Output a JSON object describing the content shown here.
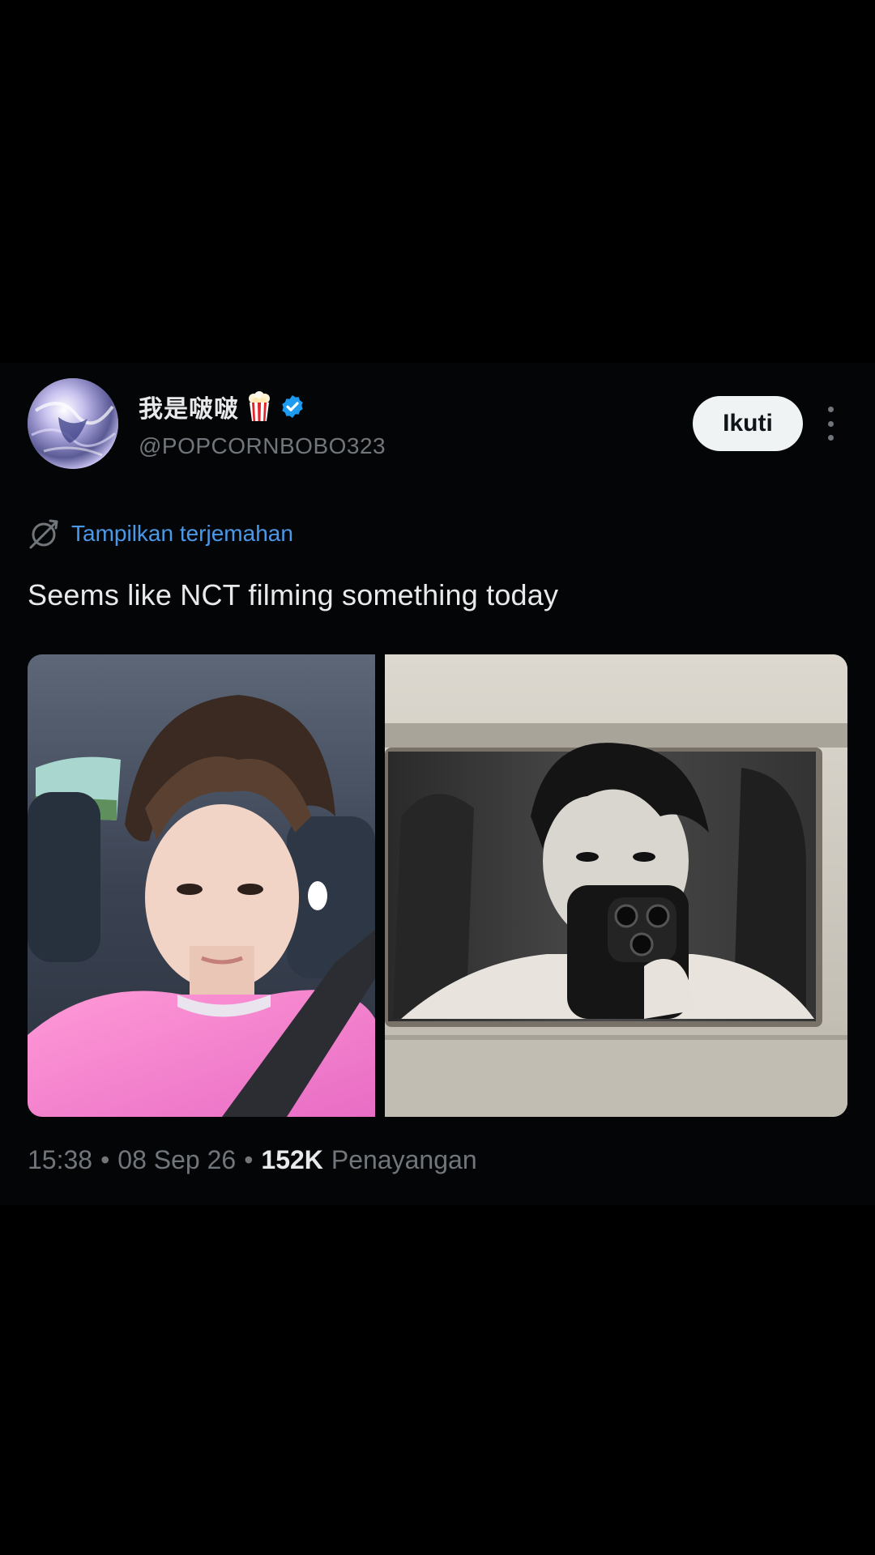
{
  "tweet": {
    "author": {
      "display_name": "我是啵啵",
      "handle": "@POPCORNBOBO323",
      "badge_icon": "popcorn-icon",
      "verified_icon": "verified-badge-icon",
      "verified_color": "#1d9bf0"
    },
    "follow_label": "Ikuti",
    "more_icon": "more-vertical-icon",
    "translate": {
      "icon": "translate-globe-icon",
      "label": "Tampilkan terjemahan",
      "color": "#4a99e9"
    },
    "text": "Seems like NCT filming something today",
    "media": [
      {
        "kind": "photo",
        "description_icon": "photo-selfie-car"
      },
      {
        "kind": "photo",
        "description_icon": "photo-mirror-selfie"
      }
    ],
    "meta": {
      "time": "15:38",
      "separator": "•",
      "date": "08 Sep 26",
      "views_count": "152K",
      "views_label": "Penayangan"
    }
  },
  "colors": {
    "background": "#000000",
    "text_primary": "#e7e9ea",
    "text_secondary": "#71767b",
    "follow_bg": "#eff3f4",
    "follow_text": "#0f1419"
  }
}
